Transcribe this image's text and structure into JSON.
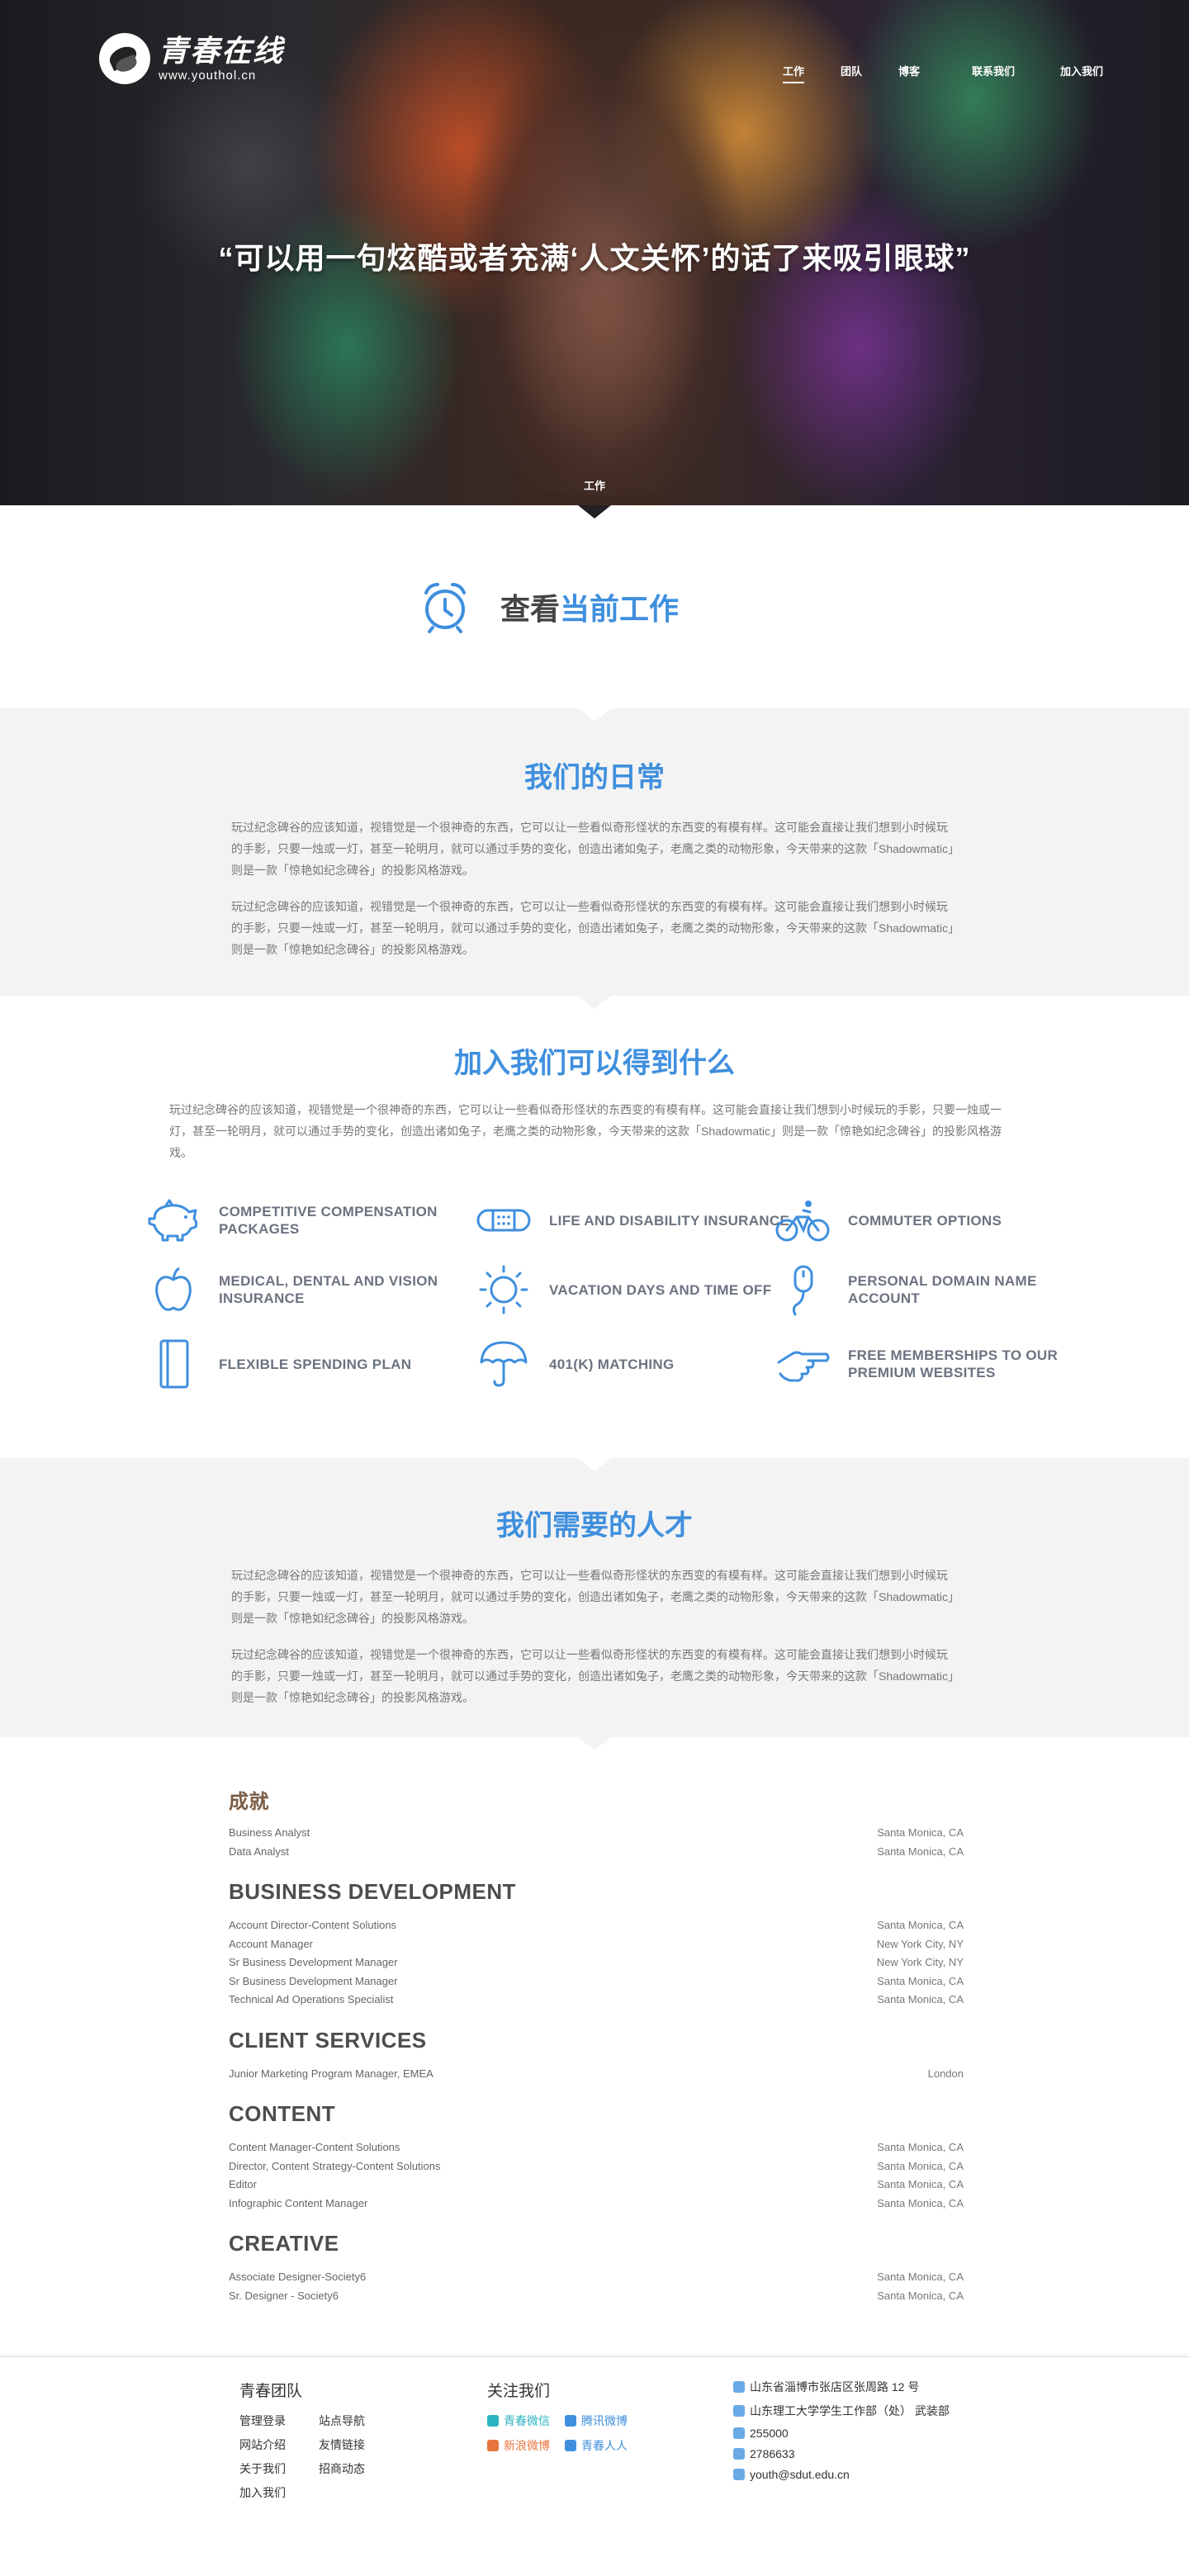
{
  "brand": {
    "title": "青春在线",
    "url": "www.youthol.cn"
  },
  "nav": {
    "items": [
      "工作",
      "团队",
      "博客",
      "联系我们",
      "加入我们"
    ]
  },
  "hero": {
    "quote": "“可以用一句炫酷或者充满‘人文关怀’的话了来吸引眼球”",
    "tab_label": "工作"
  },
  "current": {
    "prefix": "查看",
    "highlight": "当前工作"
  },
  "daily": {
    "title": "我们的日常",
    "paragraphs": [
      "玩过纪念碑谷的应该知道，视错觉是一个很神奇的东西，它可以让一些看似奇形怪状的东西变的有模有样。这可能会直接让我们想到小时候玩的手影，只要一烛或一灯，甚至一轮明月，就可以通过手势的变化，创造出诸如兔子，老鹰之类的动物形象，今天带来的这款「Shadowmatic」则是一款「惊艳如纪念碑谷」的投影风格游戏。",
      "玩过纪念碑谷的应该知道，视错觉是一个很神奇的东西，它可以让一些看似奇形怪状的东西变的有模有样。这可能会直接让我们想到小时候玩的手影，只要一烛或一灯，甚至一轮明月，就可以通过手势的变化，创造出诸如兔子，老鹰之类的动物形象，今天带来的这款「Shadowmatic」则是一款「惊艳如纪念碑谷」的投影风格游戏。"
    ]
  },
  "benefits": {
    "title": "加入我们可以得到什么",
    "paragraph": "玩过纪念碑谷的应该知道，视错觉是一个很神奇的东西，它可以让一些看似奇形怪状的东西变的有模有样。这可能会直接让我们想到小时候玩的手影，只要一烛或一灯，甚至一轮明月，就可以通过手势的变化，创造出诸如兔子，老鹰之类的动物形象，今天带来的这款「Shadowmatic」则是一款「惊艳如纪念碑谷」的投影风格游戏。",
    "items": [
      {
        "label": "COMPETITIVE COMPENSATION PACKAGES",
        "icon": "piggy-bank-icon"
      },
      {
        "label": "LIFE AND DISABILITY INSURANCE",
        "icon": "bandage-icon"
      },
      {
        "label": "COMMUTER OPTIONS",
        "icon": "cyclist-icon"
      },
      {
        "label": "MEDICAL, DENTAL AND VISION INSURANCE",
        "icon": "apple-icon"
      },
      {
        "label": "VACATION DAYS AND TIME OFF",
        "icon": "sun-icon"
      },
      {
        "label": "PERSONAL DOMAIN NAME ACCOUNT",
        "icon": "mouse-icon"
      },
      {
        "label": "FLEXIBLE SPENDING PLAN",
        "icon": "notebook-icon"
      },
      {
        "label": "401(K) MATCHING",
        "icon": "umbrella-icon"
      },
      {
        "label": "FREE MEMBERSHIPS TO OUR PREMIUM WEBSITES",
        "icon": "pointing-hand-icon"
      }
    ]
  },
  "talent": {
    "title": "我们需要的人才",
    "paragraphs": [
      "玩过纪念碑谷的应该知道，视错觉是一个很神奇的东西，它可以让一些看似奇形怪状的东西变的有模有样。这可能会直接让我们想到小时候玩的手影，只要一烛或一灯，甚至一轮明月，就可以通过手势的变化，创造出诸如兔子，老鹰之类的动物形象，今天带来的这款「Shadowmatic」则是一款「惊艳如纪念碑谷」的投影风格游戏。",
      "玩过纪念碑谷的应该知道，视错觉是一个很神奇的东西，它可以让一些看似奇形怪状的东西变的有模有样。这可能会直接让我们想到小时候玩的手影，只要一烛或一灯，甚至一轮明月，就可以通过手势的变化，创造出诸如兔子，老鹰之类的动物形象，今天带来的这款「Shadowmatic」则是一款「惊艳如纪念碑谷」的投影风格游戏。"
    ]
  },
  "jobs": [
    {
      "heading": "成就",
      "rows": [
        {
          "title": "Business Analyst",
          "location": "Santa Monica, CA"
        },
        {
          "title": "Data Analyst",
          "location": "Santa Monica, CA"
        }
      ]
    },
    {
      "heading": "BUSINESS DEVELOPMENT",
      "rows": [
        {
          "title": "Account Director-Content Solutions",
          "location": "Santa Monica, CA"
        },
        {
          "title": "Account Manager",
          "location": "New York City, NY"
        },
        {
          "title": "Sr Business Development Manager",
          "location": "New York City, NY"
        },
        {
          "title": "Sr Business Development Manager",
          "location": "Santa Monica, CA"
        },
        {
          "title": "Technical Ad Operations Specialist",
          "location": "Santa Monica, CA"
        }
      ]
    },
    {
      "heading": "CLIENT SERVICES",
      "rows": [
        {
          "title": "Junior Marketing Program Manager, EMEA",
          "location": "London"
        }
      ]
    },
    {
      "heading": "CONTENT",
      "rows": [
        {
          "title": "Content Manager-Content Solutions",
          "location": "Santa Monica, CA"
        },
        {
          "title": "Director, Content Strategy-Content Solutions",
          "location": "Santa Monica, CA"
        },
        {
          "title": "Editor",
          "location": "Santa Monica, CA"
        },
        {
          "title": "Infographic Content Manager",
          "location": "Santa Monica, CA"
        }
      ]
    },
    {
      "heading": "CREATIVE",
      "rows": [
        {
          "title": "Associate Designer-Society6",
          "location": "Santa Monica, CA"
        },
        {
          "title": "Sr. Designer - Society6",
          "location": "Santa Monica, CA"
        }
      ]
    }
  ],
  "footer": {
    "team": {
      "heading": "青春团队",
      "links": [
        "管理登录",
        "站点导航",
        "网站介绍",
        "友情链接",
        "关于我们",
        "招商动态",
        "加入我们"
      ]
    },
    "follow": {
      "heading": "关注我们",
      "links": [
        {
          "label": "青春微信",
          "color": "#2bb3c0"
        },
        {
          "label": "腾讯微博",
          "color": "#3f8fde"
        },
        {
          "label": "新浪微博",
          "color": "#e8743b"
        },
        {
          "label": "青春人人",
          "color": "#3f8fde"
        }
      ]
    },
    "contact": [
      "山东省淄博市张店区张周路 12 号",
      "山东理工大学学生工作部（处） 武装部",
      "255000",
      "2786633",
      "youth@sdut.edu.cn"
    ]
  },
  "colors": {
    "accent": "#3f8fde",
    "grey_bg": "#f3f3f3"
  }
}
